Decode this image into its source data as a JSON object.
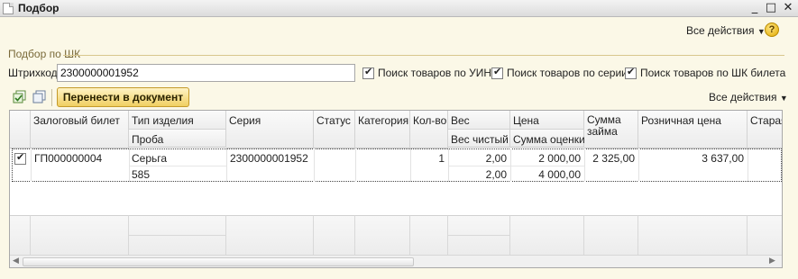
{
  "window": {
    "title": "Подбор",
    "controls": [
      "_",
      "□",
      "✕"
    ]
  },
  "top_menu": {
    "all_actions": "Все действия"
  },
  "help": "?",
  "group": {
    "title": "Подбор по ШК"
  },
  "barcode": {
    "label": "Штрихкод:",
    "value": "2300000001952"
  },
  "options": [
    {
      "label": "Поиск товаров по УИН",
      "checked": true
    },
    {
      "label": "Поиск товаров по серии",
      "checked": true
    },
    {
      "label": "Поиск товаров по ШК билета",
      "checked": true
    }
  ],
  "toolbar": {
    "transfer_label": "Перенести в документ",
    "all_actions": "Все действия"
  },
  "table": {
    "columns": {
      "ticket": "Залоговый билет",
      "item_type": "Тип изделия",
      "probe": "Проба",
      "series": "Серия",
      "status": "Статус",
      "category": "Категория",
      "qty": "Кол-во",
      "weight": "Вес",
      "net_weight": "Вес чистый",
      "price": "Цена",
      "valuation": "Сумма оценки",
      "loan_sum": "Сумма займа",
      "retail_price": "Розничная цена",
      "old": "Старая"
    },
    "rows": [
      {
        "checked": true,
        "ticket": "ГП000000004",
        "item_type": "Серьга",
        "probe": "585",
        "series": "2300000001952",
        "qty": "1",
        "weight": "2,00",
        "net_weight": "2,00",
        "price": "2 000,00",
        "valuation": "4 000,00",
        "loan_sum": "2 325,00",
        "retail_price": "3 637,00"
      }
    ]
  }
}
